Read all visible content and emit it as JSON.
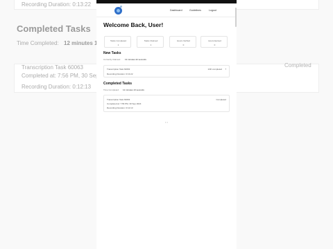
{
  "background": {
    "top_text": "Recording Duration: 0:13:22",
    "heading": "Completed Tasks",
    "time_completed_label": "Time Completed:",
    "time_completed_value": "12 minutes 1",
    "task_title": "Transcription Task 60063",
    "completed_at": "Completed at: 7:56 PM, 30 Sep",
    "duration": "Recording Duration: 0:12:13",
    "status": "Completed"
  },
  "nav": {
    "links": [
      "Dashboard",
      "Guidelines",
      "Logout"
    ]
  },
  "welcome": "Welcome Back, User!",
  "stats": [
    {
      "label": "Tasks Completed",
      "value": "1"
    },
    {
      "label": "Tasks Claimed",
      "value": "1"
    },
    {
      "label": "Hours Verified",
      "value": "0"
    },
    {
      "label": "Hours Earned",
      "value": "0"
    }
  ],
  "new_tasks": {
    "title": "New Tasks",
    "duration_label": "Currently Claimed:",
    "duration_value": "13 minutes 22 seconds",
    "task": {
      "name": "Transcription Task 60063",
      "progress": "13th completed",
      "duration": "Recording Duration: 0:13:22"
    }
  },
  "completed_tasks": {
    "title": "Completed Tasks",
    "time_label": "Time Completed:",
    "time_value": "12 minutes 13 seconds",
    "task": {
      "name": "Transcription Task 60063",
      "completed_at": "Completed at: 7:56 PM, 30 Sep 2024",
      "duration": "Recording Duration: 0:12:13",
      "status": "Completed"
    }
  },
  "loading_indicator": "• •"
}
